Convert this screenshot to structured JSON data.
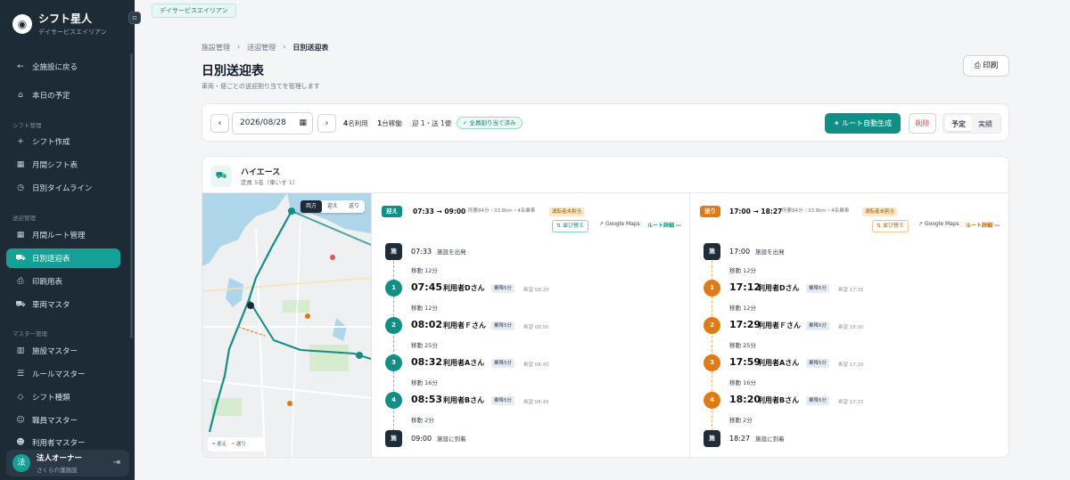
{
  "app": {
    "title": "シフト星人",
    "subtitle": "デイサービスエイリアン",
    "collapse_icon": "sidebar-collapse-icon"
  },
  "sidebar": {
    "back_label": "全施設に戻る",
    "today_label": "本日の予定",
    "sections": {
      "shift": "シフト管理",
      "transport": "送迎管理",
      "master": "マスター管理"
    },
    "items": [
      {
        "label": "シフト作成",
        "icon": "plus-icon"
      },
      {
        "label": "月間シフト表",
        "icon": "calendar-icon"
      },
      {
        "label": "日別タイムライン",
        "icon": "clock-icon"
      },
      {
        "label": "月間ルート管理",
        "icon": "calendar-icon"
      },
      {
        "label": "日別送迎表",
        "icon": "car-icon",
        "active": true
      },
      {
        "label": "印刷用表",
        "icon": "printer-icon"
      },
      {
        "label": "車両マスタ",
        "icon": "car-icon"
      },
      {
        "label": "施設マスター",
        "icon": "building-icon"
      },
      {
        "label": "ルールマスター",
        "icon": "rules-icon"
      },
      {
        "label": "シフト種類",
        "icon": "tag-icon"
      },
      {
        "label": "職員マスター",
        "icon": "staff-icon"
      },
      {
        "label": "利用者マスター",
        "icon": "users-icon"
      }
    ],
    "user": {
      "avatar": "法",
      "name": "法人オーナー",
      "org": "さくら介護施設"
    }
  },
  "facility_tab": "デイサービスエイリアン",
  "breadcrumb": [
    "施設管理",
    "送迎管理",
    "日別送迎表"
  ],
  "page": {
    "title": "日別送迎表",
    "subtitle": "車両・便ごとの送迎割り当てを管理します",
    "print_label": "印刷"
  },
  "toolbar": {
    "prev": "‹",
    "next": "›",
    "date": "2026/08/28",
    "users_num": "4",
    "users_label": "名利用",
    "vehicles_num": "1",
    "vehicles_label": "台稼働",
    "trips_label": "迎 1・送 1便",
    "all_assigned": "全員割り当て済み",
    "auto_route": "ルート自動生成",
    "delete": "削除",
    "mode_plan": "予定",
    "mode_actual": "実績"
  },
  "vehicle": {
    "name": "ハイエース",
    "capacity": "定員 5名（車いす 1）"
  },
  "map": {
    "tabs": [
      "両方",
      "迎え",
      "送り"
    ],
    "active_tab": "両方",
    "legend_pick": "迎え",
    "legend_drop": "送り",
    "colors": {
      "pick": "#0f8f85",
      "drop": "#e07a14"
    }
  },
  "pickup": {
    "tag": "迎え",
    "time_range": "07:33 → 09:00",
    "meta": "所要84分・33.8km・4名乗車",
    "warning": "運転者未割当",
    "reorder": "並び替え",
    "gmaps": "Google Maps",
    "detail": "ルート詳細 ―",
    "start": {
      "badge": "施",
      "time": "07:33",
      "label": "施設を出発"
    },
    "moves": [
      "移動 12分",
      "移動 12分",
      "移動 25分",
      "移動 16分",
      "移動 2分"
    ],
    "stops": [
      {
        "n": "1",
        "time": "07:45",
        "name": "利用者Dさん",
        "badge": "乗降5分",
        "wish": "希望 08:25"
      },
      {
        "n": "2",
        "time": "08:02",
        "name": "利用者Ｆさん",
        "badge": "乗降5分",
        "wish": "希望 08:00"
      },
      {
        "n": "3",
        "time": "08:32",
        "name": "利用者Aさん",
        "badge": "乗降5分",
        "wish": "希望 08:40"
      },
      {
        "n": "4",
        "time": "08:53",
        "name": "利用者Bさん",
        "badge": "乗降5分",
        "wish": "希望 08:45"
      }
    ],
    "end": {
      "badge": "施",
      "time": "09:00",
      "label": "施設に到着"
    }
  },
  "dropoff": {
    "tag": "送り",
    "time_range": "17:00 → 18:27",
    "meta": "所要84分・33.8km・4名乗車",
    "warning": "運転者未割当",
    "reorder": "並び替え",
    "gmaps": "Google Maps",
    "detail": "ルート詳細 ―",
    "start": {
      "badge": "施",
      "time": "17:00",
      "label": "施設を出発"
    },
    "moves": [
      "移動 12分",
      "移動 12分",
      "移動 25分",
      "移動 16分",
      "移動 2分"
    ],
    "stops": [
      {
        "n": "1",
        "time": "17:12",
        "name": "利用者Dさん",
        "badge": "乗降5分",
        "wish": "希望 17:35"
      },
      {
        "n": "2",
        "time": "17:29",
        "name": "利用者Ｆさん",
        "badge": "乗降5分",
        "wish": "希望 18:00"
      },
      {
        "n": "3",
        "time": "17:59",
        "name": "利用者Aさん",
        "badge": "乗降5分",
        "wish": "希望 17:20"
      },
      {
        "n": "4",
        "time": "18:20",
        "name": "利用者Bさん",
        "badge": "乗降5分",
        "wish": "希望 17:15"
      }
    ],
    "end": {
      "badge": "施",
      "time": "18:27",
      "label": "施設に到着"
    }
  }
}
